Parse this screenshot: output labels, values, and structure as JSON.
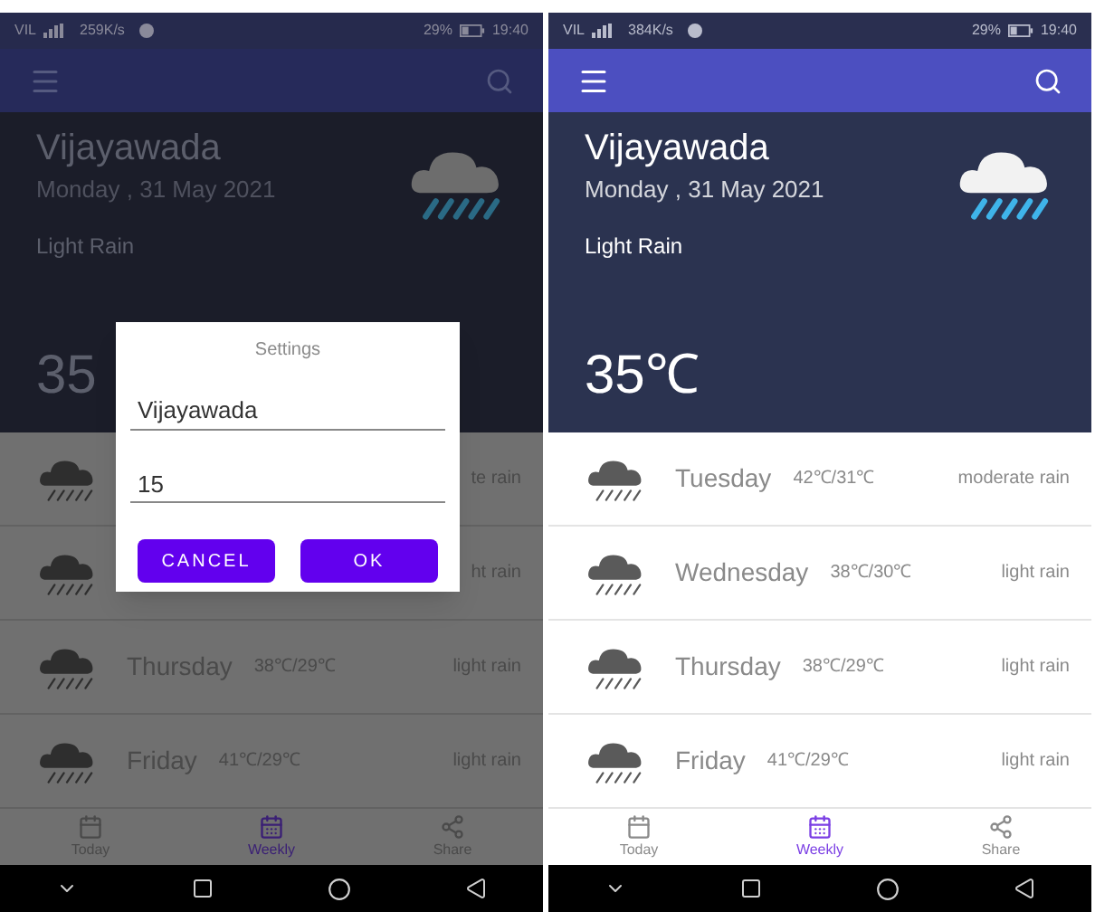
{
  "screens": [
    {
      "dimmed": true,
      "status_bar": {
        "carrier": "VIL",
        "speed": "259K/s",
        "battery": "29%",
        "time": "19:40"
      },
      "header": {
        "city": "Vijayawada",
        "date": "Monday , 31 May 2021",
        "condition": "Light Rain",
        "temperature": "35"
      },
      "forecast": [
        {
          "description": "te rain"
        },
        {
          "description": "ht rain"
        },
        {
          "day": "Thursday",
          "temps": "38℃/29℃",
          "description": "light rain"
        },
        {
          "day": "Friday",
          "temps": "41℃/29℃",
          "description": "light rain"
        }
      ],
      "bottom_nav": [
        {
          "label": "Today",
          "selected": false
        },
        {
          "label": "Weekly",
          "selected": true
        },
        {
          "label": "Share",
          "selected": false
        }
      ],
      "dialog": {
        "title": "Settings",
        "city_value": "Vijayawada",
        "days_value": "15",
        "buttons": [
          "CANCEL",
          "OK"
        ]
      }
    },
    {
      "dimmed": false,
      "status_bar": {
        "carrier": "VIL",
        "speed": "384K/s",
        "battery": "29%",
        "time": "19:40"
      },
      "header": {
        "city": "Vijayawada",
        "date": "Monday , 31 May 2021",
        "condition": "Light Rain",
        "temperature": "35℃"
      },
      "forecast": [
        {
          "day": "Tuesday",
          "temps": "42℃/31℃",
          "description": "moderate rain"
        },
        {
          "day": "Wednesday",
          "temps": "38℃/30℃",
          "description": "light rain"
        },
        {
          "day": "Thursday",
          "temps": "38℃/29℃",
          "description": "light rain"
        },
        {
          "day": "Friday",
          "temps": "41℃/29℃",
          "description": "light rain"
        }
      ],
      "bottom_nav": [
        {
          "label": "Today",
          "selected": false
        },
        {
          "label": "Weekly",
          "selected": true
        },
        {
          "label": "Share",
          "selected": false
        }
      ]
    }
  ]
}
